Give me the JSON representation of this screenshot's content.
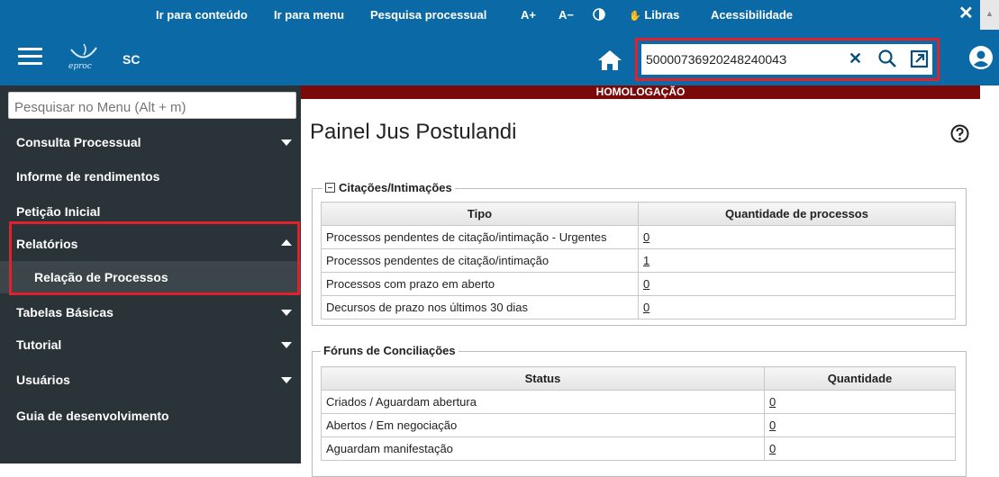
{
  "topbar": {
    "links": [
      "Ir para conteúdo",
      "Ir para menu",
      "Pesquisa processual",
      "A+",
      "A−",
      "Libras",
      "Acessibilidade"
    ]
  },
  "header": {
    "logo_text": "eproc",
    "region": "SC",
    "search_value": "5000073692024824004З"
  },
  "sidebar": {
    "search_placeholder": "Pesquisar no Menu (Alt + m)",
    "items": [
      {
        "label": "Consulta Processual"
      },
      {
        "label": "Informe de rendimentos"
      },
      {
        "label": "Petição Inicial"
      },
      {
        "label": "Relatórios"
      },
      {
        "label": "Relação de Processos"
      },
      {
        "label": "Tabelas Básicas"
      },
      {
        "label": "Tutorial"
      },
      {
        "label": "Usuários"
      },
      {
        "label": "Guia de desenvolvimento"
      }
    ]
  },
  "main": {
    "environment_banner": "HOMOLOGAÇÃO",
    "title": "Painel Jus Postulandi",
    "citacoes": {
      "legend": "Citações/Intimações",
      "headers": [
        "Tipo",
        "Quantidade de processos"
      ],
      "rows": [
        {
          "tipo": "Processos pendentes de citação/intimação - Urgentes",
          "qtd": "0"
        },
        {
          "tipo": "Processos pendentes de citação/intimação",
          "qtd": "1"
        },
        {
          "tipo": "Processos com prazo em aberto",
          "qtd": "0"
        },
        {
          "tipo": "Decursos de prazo nos últimos 30 dias",
          "qtd": "0"
        }
      ]
    },
    "foruns": {
      "legend": "Fóruns de Conciliações",
      "headers": [
        "Status",
        "Quantidade"
      ],
      "rows": [
        {
          "status": "Criados / Aguardam abertura",
          "qtd": "0"
        },
        {
          "status": "Abertos / Em negociação",
          "qtd": "0"
        },
        {
          "status": "Aguardam manifestação",
          "qtd": "0"
        }
      ]
    }
  },
  "colors": {
    "header_blue": "#0b6aa6",
    "sidebar_dark": "#2a3338",
    "homolog_red": "#7a0a0a",
    "highlight_red": "#e0202a"
  }
}
